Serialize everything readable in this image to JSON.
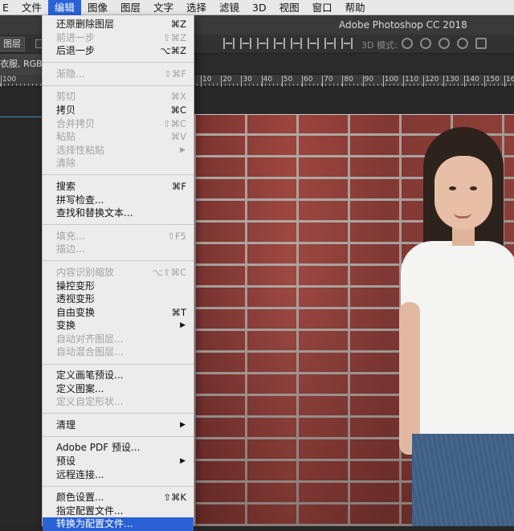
{
  "menubar": {
    "items": [
      "E",
      "文件",
      "编辑",
      "图像",
      "图层",
      "文字",
      "选择",
      "滤镜",
      "3D",
      "视图",
      "窗口",
      "帮助"
    ],
    "active_index": 2
  },
  "app": {
    "title": "Adobe Photoshop CC 2018"
  },
  "options_bar": {
    "layer_select": "图层",
    "mode_3d_label": "3D 模式:"
  },
  "document": {
    "tab_label": "衣服, RGB/8"
  },
  "ruler": {
    "left_label": "100",
    "labels": [
      "10",
      "20",
      "30",
      "40",
      "50",
      "60",
      "70",
      "80",
      "90",
      "100",
      "110",
      "120",
      "130",
      "140",
      "150",
      "160"
    ]
  },
  "edit_menu": {
    "groups": [
      [
        {
          "label": "还原删除图层",
          "shortcut": "⌘Z",
          "enabled": true
        },
        {
          "label": "前进一步",
          "shortcut": "⇧⌘Z",
          "enabled": false
        },
        {
          "label": "后退一步",
          "shortcut": "⌥⌘Z",
          "enabled": true
        }
      ],
      [
        {
          "label": "渐隐...",
          "shortcut": "⇧⌘F",
          "enabled": false
        }
      ],
      [
        {
          "label": "剪切",
          "shortcut": "⌘X",
          "enabled": false
        },
        {
          "label": "拷贝",
          "shortcut": "⌘C",
          "enabled": true
        },
        {
          "label": "合并拷贝",
          "shortcut": "⇧⌘C",
          "enabled": false
        },
        {
          "label": "粘贴",
          "shortcut": "⌘V",
          "enabled": false
        },
        {
          "label": "选择性粘贴",
          "submenu": true,
          "enabled": false
        },
        {
          "label": "清除",
          "enabled": false
        }
      ],
      [
        {
          "label": "搜索",
          "shortcut": "⌘F",
          "enabled": true
        },
        {
          "label": "拼写检查...",
          "enabled": true
        },
        {
          "label": "查找和替换文本...",
          "enabled": true
        }
      ],
      [
        {
          "label": "填充...",
          "shortcut": "⇧F5",
          "enabled": false
        },
        {
          "label": "描边...",
          "enabled": false
        }
      ],
      [
        {
          "label": "内容识别缩放",
          "shortcut": "⌥⇧⌘C",
          "enabled": false
        },
        {
          "label": "操控变形",
          "enabled": true
        },
        {
          "label": "透视变形",
          "enabled": true
        },
        {
          "label": "自由变换",
          "shortcut": "⌘T",
          "enabled": true
        },
        {
          "label": "变换",
          "submenu": true,
          "enabled": true
        },
        {
          "label": "自动对齐图层...",
          "enabled": false
        },
        {
          "label": "自动混合图层...",
          "enabled": false
        }
      ],
      [
        {
          "label": "定义画笔预设...",
          "enabled": true
        },
        {
          "label": "定义图案...",
          "enabled": true
        },
        {
          "label": "定义自定形状...",
          "enabled": false
        }
      ],
      [
        {
          "label": "清理",
          "submenu": true,
          "enabled": true
        }
      ],
      [
        {
          "label": "Adobe PDF 预设...",
          "enabled": true
        },
        {
          "label": "预设",
          "submenu": true,
          "enabled": true
        },
        {
          "label": "远程连接...",
          "enabled": true
        }
      ],
      [
        {
          "label": "颜色设置...",
          "shortcut": "⇧⌘K",
          "enabled": true
        },
        {
          "label": "指定配置文件...",
          "enabled": true
        },
        {
          "label": "转换为配置文件...",
          "enabled": true,
          "highlighted": true
        }
      ]
    ]
  }
}
